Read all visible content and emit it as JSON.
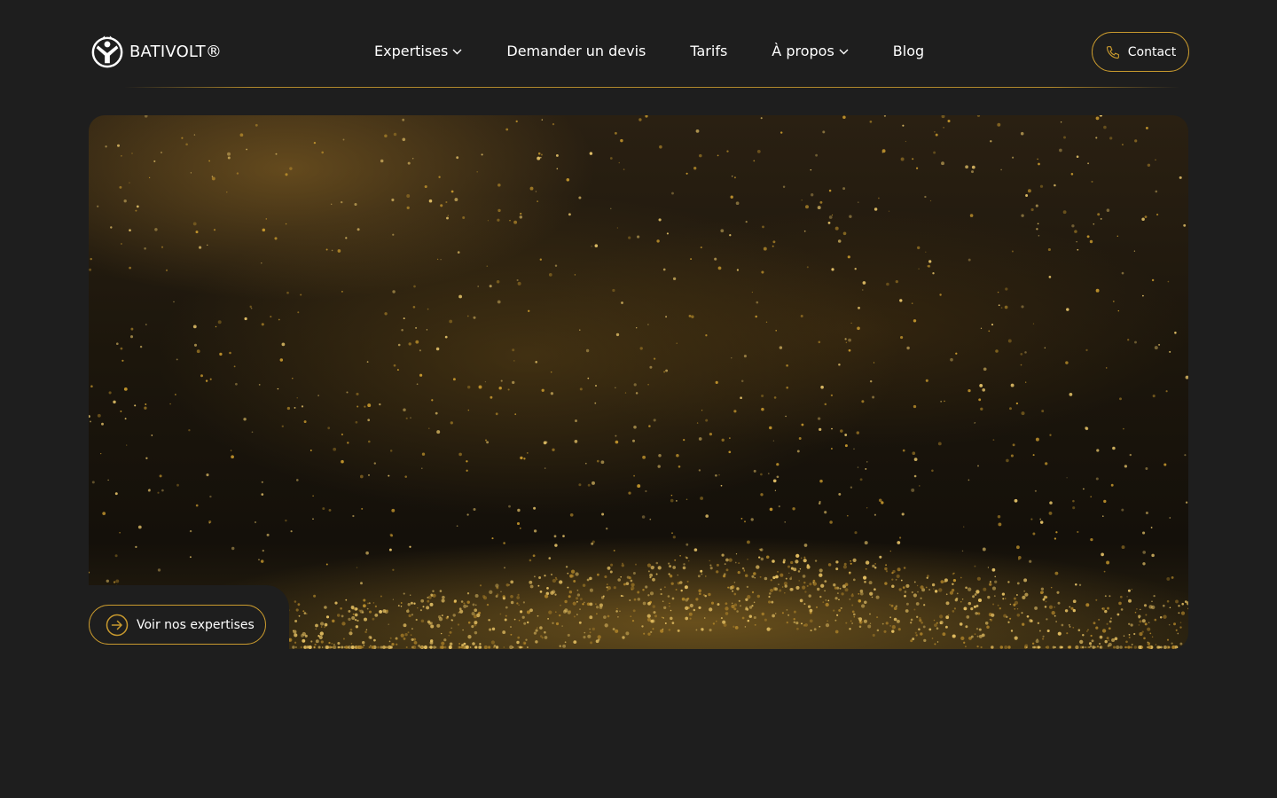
{
  "brand": {
    "name": "BATIVOLT®",
    "logo_icon": "bativolt-person-icon"
  },
  "nav": {
    "items": [
      {
        "label": "Expertises",
        "has_dropdown": true
      },
      {
        "label": "Demander un devis",
        "has_dropdown": false
      },
      {
        "label": "Tarifs",
        "has_dropdown": false
      },
      {
        "label": "À propos",
        "has_dropdown": true
      },
      {
        "label": "Blog",
        "has_dropdown": false
      }
    ]
  },
  "contact": {
    "label": "Contact",
    "icon": "phone-icon"
  },
  "hero": {
    "background": "golden-particles-image",
    "cta_label": "Voir nos expertises",
    "cta_icon": "arrow-right-circle-icon"
  },
  "colors": {
    "page_background": "#1e1e1e",
    "accent": "#c99a2e",
    "text": "#ffffff"
  }
}
